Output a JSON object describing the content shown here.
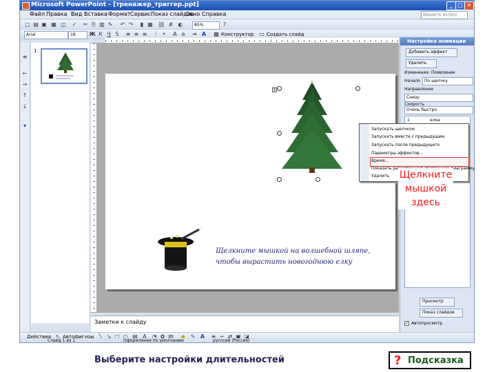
{
  "window": {
    "title": "Microsoft PowerPoint - [тренажер_триггер.ppt]",
    "buttons": [
      "_",
      "□",
      "✕"
    ]
  },
  "menubar": {
    "items": [
      "Файл",
      "Правка",
      "Вид",
      "Вставка",
      "Формат",
      "Сервис",
      "Показ слайдов",
      "Окно",
      "Справка"
    ],
    "ask_placeholder": "Введите вопрос"
  },
  "toolbar": {
    "zoom": "85%",
    "font": "Arial",
    "size": "18",
    "design_label": "Конструктор",
    "new_slide_label": "Создать слайд"
  },
  "thumbnails": {
    "slide_number": "1"
  },
  "slide": {
    "text_line1": "Щелкните мышкой на волшебной шляпе,",
    "text_line2": "чтобы вырастить новогоднюю елку"
  },
  "notes": {
    "placeholder": "Заметки к слайду"
  },
  "taskpane": {
    "title": "Настройка анимации",
    "add_effect": "Добавить эффект",
    "remove": "Удалить",
    "change_label": "Изменение: Появление",
    "start_label": "Начало",
    "start_value": "По щелчку",
    "direction_label": "Направление",
    "direction_value": "Снизу",
    "speed_label": "Скорость",
    "speed_value": "Очень быстро",
    "list_item": "1",
    "list_item_name": "елка",
    "play": "Просмотр",
    "slideshow": "Показ слайдов",
    "autopreview": "Автопросмотр"
  },
  "context_menu": {
    "items": [
      "Запускать щелчком",
      "Запускать вместе с предыдущим",
      "Запускать после предыдущего",
      "Параметры эффектов...",
      "Время...",
      "Показать расширенную временную диаграмму",
      "Удалить"
    ]
  },
  "drawbar": {
    "draw_label": "Действия",
    "autoshapes_label": "Автофигуры"
  },
  "statusbar": {
    "slide_info": "Слайд 1 из 1",
    "design": "Оформление по умолчанию",
    "language": "русский (Россия)"
  },
  "callout": {
    "line1": "Щелкните",
    "line2": "мышкой",
    "line3": "здесь"
  },
  "instruction": "Выберите настройки длительностей",
  "hint": {
    "symbol": "?",
    "label": "Подсказка"
  }
}
